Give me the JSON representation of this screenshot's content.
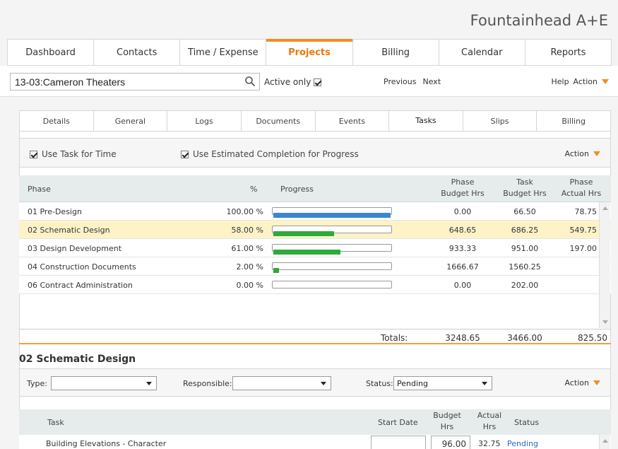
{
  "brand": {
    "name": "Fountainhead A+E"
  },
  "main_tabs": [
    {
      "label": "Dashboard"
    },
    {
      "label": "Contacts"
    },
    {
      "label": "Time / Expense"
    },
    {
      "label": "Projects"
    },
    {
      "label": "Billing"
    },
    {
      "label": "Calendar"
    },
    {
      "label": "Reports"
    }
  ],
  "search": {
    "project_value": "13-03:Cameron Theaters",
    "active_only_label": "Active only",
    "previous": "Previous",
    "next": "Next",
    "help": "Help",
    "action": "Action"
  },
  "sub_tabs": [
    {
      "label": "Details"
    },
    {
      "label": "General"
    },
    {
      "label": "Logs"
    },
    {
      "label": "Documents"
    },
    {
      "label": "Events"
    },
    {
      "label": "Tasks"
    },
    {
      "label": "Slips"
    },
    {
      "label": "Billing"
    }
  ],
  "options": {
    "use_task_for_time": "Use Task for Time",
    "use_estimated_completion": "Use Estimated Completion for Progress",
    "action": "Action"
  },
  "phase_table": {
    "headers": {
      "phase": "Phase",
      "percent": "%",
      "progress": "Progress",
      "phase_budget_1": "Phase",
      "phase_budget_2": "Budget Hrs",
      "task_budget_1": "Task",
      "task_budget_2": "Budget Hrs",
      "phase_actual_1": "Phase",
      "phase_actual_2": "Actual Hrs"
    },
    "rows": [
      {
        "phase": "01 Pre-Design",
        "percent": "100.00 %",
        "progress": 1.0,
        "bar_color": "#3a86d4",
        "phase_budget": "0.00",
        "task_budget": "66.50",
        "phase_actual": "78.75"
      },
      {
        "phase": "02 Schematic Design",
        "percent": "58.00 %",
        "progress": 0.52,
        "bar_color": "#2eaa3a",
        "phase_budget": "648.65",
        "task_budget": "686.25",
        "phase_actual": "549.75"
      },
      {
        "phase": "03 Design Development",
        "percent": "61.00 %",
        "progress": 0.57,
        "bar_color": "#2eaa3a",
        "phase_budget": "933.33",
        "task_budget": "951.00",
        "phase_actual": "197.00"
      },
      {
        "phase": "04 Construction Documents",
        "percent": "2.00 %",
        "progress": 0.05,
        "bar_color": "#2eaa3a",
        "phase_budget": "1666.67",
        "task_budget": "1560.25",
        "phase_actual": ""
      },
      {
        "phase": "06 Contract Administration",
        "percent": "0.00 %",
        "progress": 0.0,
        "bar_color": "#2eaa3a",
        "phase_budget": "0.00",
        "task_budget": "202.00",
        "phase_actual": ""
      }
    ],
    "totals": {
      "label": "Totals:",
      "phase_budget": "3248.65",
      "task_budget": "3466.00",
      "phase_actual": "825.50"
    }
  },
  "section": {
    "title": "02 Schematic Design"
  },
  "filters": {
    "type_label": "Type:",
    "type_value": "",
    "responsible_label": "Responsible:",
    "responsible_value": "",
    "status_label": "Status:",
    "status_value": "Pending",
    "action": "Action"
  },
  "task_table": {
    "headers": {
      "task": "Task",
      "start_date": "Start Date",
      "budget_1": "Budget",
      "budget_2": "Hrs",
      "actual_1": "Actual",
      "actual_2": "Hrs",
      "status": "Status"
    },
    "rows": [
      {
        "task": "Building Elevations - Character",
        "start_date": "",
        "budget_hrs": "96.00",
        "actual_hrs": "32.75",
        "status": "Pending"
      }
    ]
  },
  "colors": {
    "accent": "#f28c1e",
    "selected_row": "#fdf3c7",
    "link": "#2a6ab8"
  }
}
